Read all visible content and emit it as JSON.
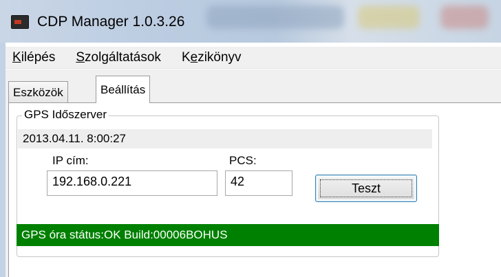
{
  "window": {
    "title": "CDP Manager 1.0.3.26",
    "app_icon": "cdp-app-icon"
  },
  "menu": {
    "items": [
      {
        "label_access": "K",
        "label_rest": "ilépés"
      },
      {
        "label_access": "S",
        "label_rest": "zolgáltatások"
      },
      {
        "label_pre": "K",
        "label_access": "e",
        "label_rest": "zikönyv"
      }
    ]
  },
  "tabs": [
    {
      "label": "Eszközök",
      "active": false
    },
    {
      "label": "Beállítás",
      "active": true
    }
  ],
  "gps_group": {
    "title": "GPS Időszerver",
    "datetime": "2013.04.11. 8:00:27",
    "ip_label": "IP cím:",
    "ip_value": "192.168.0.221",
    "pcs_label": "PCS:",
    "pcs_value": "42",
    "test_button": "Teszt",
    "status_text": "GPS óra státus:OK Build:00006BOHUS",
    "status_color": "#008000"
  }
}
